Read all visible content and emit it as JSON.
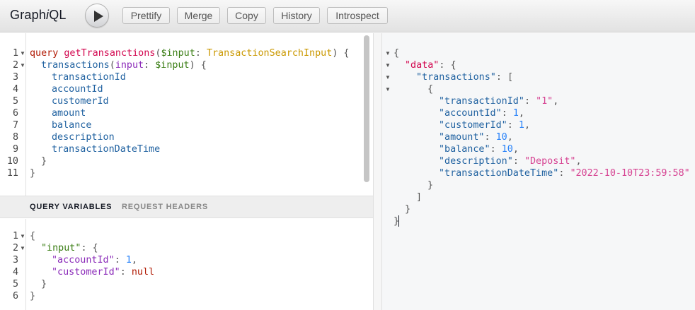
{
  "app": {
    "title_prefix": "Graph",
    "title_italic": "i",
    "title_suffix": "QL"
  },
  "toolbar": {
    "execute_button_label": "",
    "buttons": [
      "Prettify",
      "Merge",
      "Copy",
      "History",
      "Introspect"
    ]
  },
  "query_editor": {
    "line_numbers": [
      "1",
      "2",
      "3",
      "4",
      "5",
      "6",
      "7",
      "8",
      "9",
      "10",
      "11"
    ],
    "line1": {
      "keyword": "query",
      "name": "getTransanctions",
      "var": "$input",
      "type": "TransactionSearchInput"
    },
    "line2": {
      "field": "transactions",
      "arg": "input",
      "var": "$input"
    },
    "fields": [
      "transactionId",
      "accountId",
      "customerId",
      "amount",
      "balance",
      "description",
      "transactionDateTime"
    ]
  },
  "variables_panel": {
    "tabs": [
      "QUERY VARIABLES",
      "REQUEST HEADERS"
    ],
    "line_numbers": [
      "1",
      "2",
      "3",
      "4",
      "5",
      "6"
    ],
    "input_key": "\"input\"",
    "account_key": "\"accountId\"",
    "account_value": "1",
    "customer_key": "\"customerId\"",
    "customer_value": "null"
  },
  "result": {
    "data_key": "\"data\"",
    "transactions_key": "\"transactions\"",
    "rows": [
      {
        "key": "\"transactionId\"",
        "value": "\"1\"",
        "kind": "str",
        "comma": ","
      },
      {
        "key": "\"accountId\"",
        "value": "1",
        "kind": "num",
        "comma": ","
      },
      {
        "key": "\"customerId\"",
        "value": "1",
        "kind": "num",
        "comma": ","
      },
      {
        "key": "\"amount\"",
        "value": "10",
        "kind": "num",
        "comma": ","
      },
      {
        "key": "\"balance\"",
        "value": "10",
        "kind": "num",
        "comma": ","
      },
      {
        "key": "\"description\"",
        "value": "\"Deposit\"",
        "kind": "str",
        "comma": ","
      },
      {
        "key": "\"transactionDateTime\"",
        "value": "\"2022-10-10T23:59:58\"",
        "kind": "str",
        "comma": ""
      }
    ]
  },
  "colors": {
    "keyword": "#b11a04",
    "definition": "#d2054e",
    "variable": "#397d13",
    "type": "#ca9800",
    "property": "#1f61a0",
    "string": "#d64292",
    "number": "#2882f9"
  }
}
